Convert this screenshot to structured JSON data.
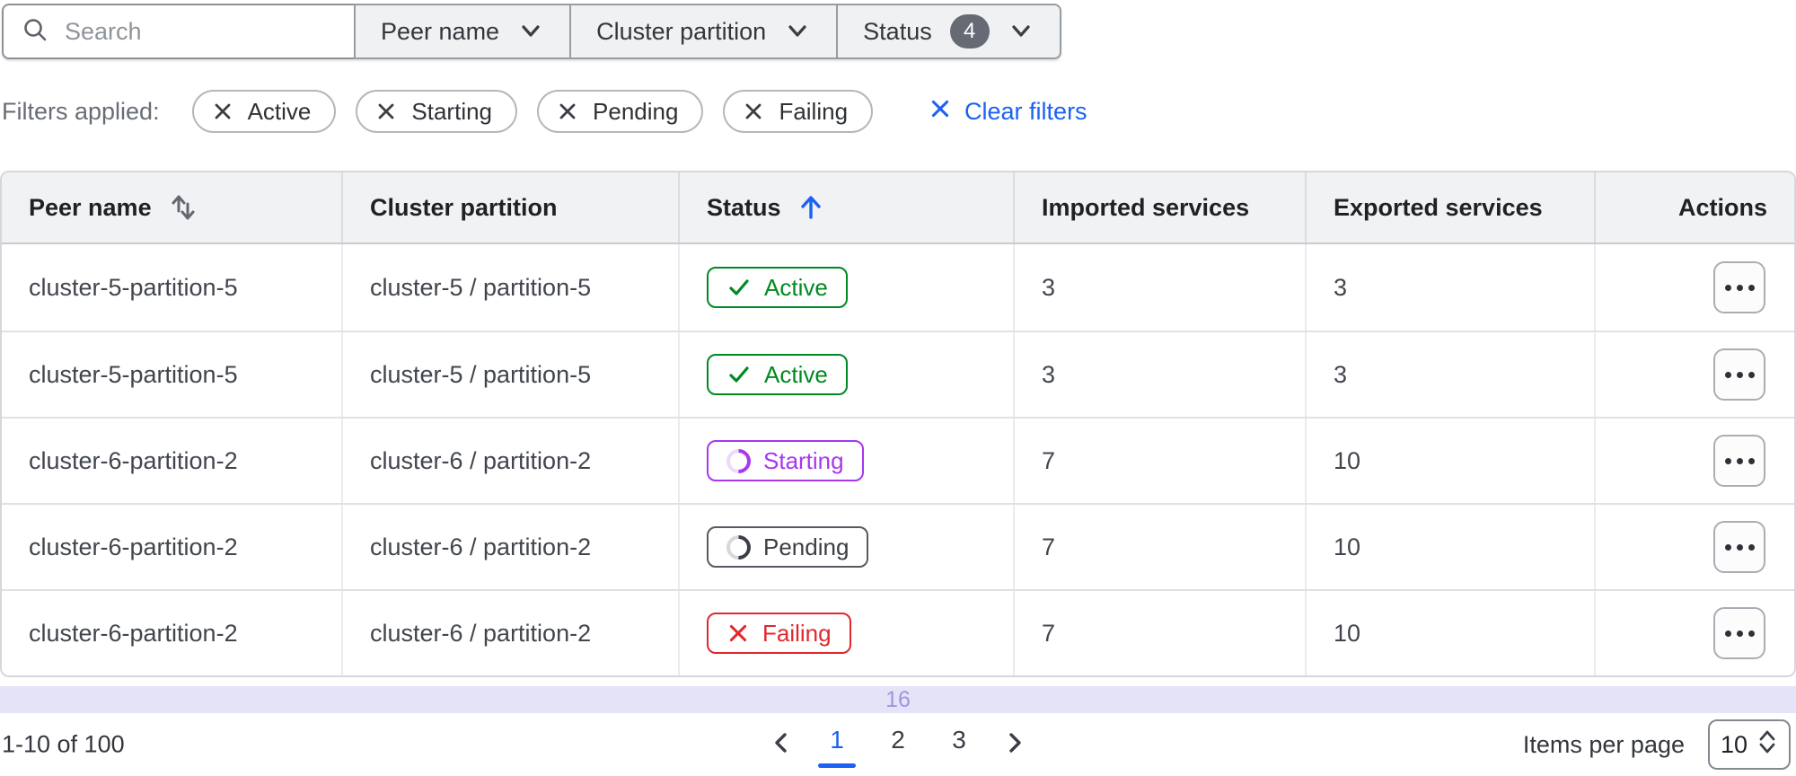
{
  "toolbar": {
    "search_placeholder": "Search",
    "dropdowns": [
      {
        "label": "Peer name"
      },
      {
        "label": "Cluster partition"
      },
      {
        "label": "Status",
        "badge": "4"
      }
    ]
  },
  "filters": {
    "label": "Filters applied:",
    "chips": [
      "Active",
      "Starting",
      "Pending",
      "Failing"
    ],
    "clear_label": "Clear filters"
  },
  "table": {
    "columns": [
      {
        "label": "Peer name",
        "sort": "both"
      },
      {
        "label": "Cluster partition",
        "sort": "none"
      },
      {
        "label": "Status",
        "sort": "asc"
      },
      {
        "label": "Imported services",
        "sort": "none"
      },
      {
        "label": "Exported services",
        "sort": "none"
      },
      {
        "label": "Actions",
        "sort": "none"
      }
    ],
    "rows": [
      {
        "peer_name": "cluster-5-partition-5",
        "cluster_partition": "cluster-5 / partition-5",
        "status": "Active",
        "imported": "3",
        "exported": "3"
      },
      {
        "peer_name": "cluster-5-partition-5",
        "cluster_partition": "cluster-5 / partition-5",
        "status": "Active",
        "imported": "3",
        "exported": "3"
      },
      {
        "peer_name": "cluster-6-partition-2",
        "cluster_partition": "cluster-6 / partition-2",
        "status": "Starting",
        "imported": "7",
        "exported": "10"
      },
      {
        "peer_name": "cluster-6-partition-2",
        "cluster_partition": "cluster-6 / partition-2",
        "status": "Pending",
        "imported": "7",
        "exported": "10"
      },
      {
        "peer_name": "cluster-6-partition-2",
        "cluster_partition": "cluster-6 / partition-2",
        "status": "Failing",
        "imported": "7",
        "exported": "10"
      }
    ]
  },
  "scroll_band": {
    "label": "16"
  },
  "footer": {
    "range_text": "1-10 of 100",
    "pages": [
      "1",
      "2",
      "3"
    ],
    "current_page": "1",
    "items_per_page_label": "Items per page",
    "items_per_page_value": "10"
  },
  "colors": {
    "active_green": "#008a22",
    "starting_purple": "#a737f0",
    "starting_purple_light": "#ecd9fc",
    "pending_dark": "#3b3e45",
    "pending_border": "#565b63",
    "pending_light": "#d6d8db",
    "failing_red": "#e0282e",
    "link_blue": "#1c61f2",
    "sort_gray": "#63676e",
    "band_bg": "#e5e3f8",
    "band_text": "#9c96e0",
    "badge_bg": "#656a74"
  }
}
